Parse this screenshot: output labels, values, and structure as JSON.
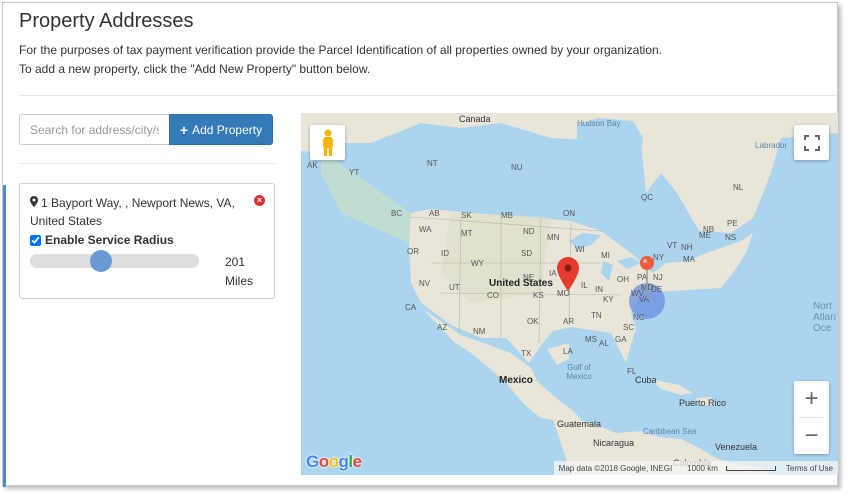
{
  "header": {
    "title": "Property Addresses",
    "description_line1": "For the purposes of tax payment verification provide the Parcel Identification of all properties owned by your organization.",
    "description_line2": "To add a new property, click the \"Add New Property\" button below."
  },
  "search": {
    "placeholder": "Search for address/city/state",
    "value": ""
  },
  "add_button": {
    "label": "Add Property",
    "icon": "plus-icon"
  },
  "properties": [
    {
      "address": "1 Bayport Way, , Newport News, VA, United States",
      "enable_service_radius_label": "Enable Service Radius",
      "enable_service_radius_checked": true,
      "radius_value": "201",
      "radius_unit": "Miles",
      "radius_fraction": 0.41
    }
  ],
  "map": {
    "labels": {
      "canada": "Canada",
      "hudson_bay": "Hudson Bay",
      "labrador": "Labrador",
      "united_states": "United States",
      "mexico": "Mexico",
      "gulf": "Gulf of Mexico",
      "north_atlantic": "Nort Atlan Oce",
      "cuba": "Cuba",
      "puerto_rico": "Puerto Rico",
      "guatemala": "Guatemala",
      "nicaragua": "Nicaragua",
      "caribbean": "Caribbean Sea",
      "venezuela": "Venezuela",
      "colombia": "Colombia"
    },
    "state_labels": [
      "AK",
      "YT",
      "NT",
      "NU",
      "BC",
      "AB",
      "SK",
      "MB",
      "ON",
      "QC",
      "NL",
      "WA",
      "MT",
      "ND",
      "MN",
      "OR",
      "ID",
      "SD",
      "WI",
      "NY",
      "ME",
      "WY",
      "NE",
      "IA",
      "MI",
      "PA",
      "NV",
      "UT",
      "CO",
      "KS",
      "MO",
      "IL",
      "IN",
      "OH",
      "WV",
      "VA",
      "CA",
      "AZ",
      "NM",
      "OK",
      "AR",
      "TN",
      "KY",
      "NC",
      "SC",
      "TX",
      "LA",
      "MS",
      "AL",
      "GA",
      "FL",
      "NH",
      "VT",
      "MA",
      "NB",
      "PE",
      "NS",
      "MD",
      "DE",
      "NJ"
    ],
    "attribution": "Map data ©2018 Google, INEGI",
    "scale": "1000 km",
    "terms": "Terms of Use",
    "logo": "Google",
    "zoom_in": "+",
    "zoom_out": "−"
  },
  "colors": {
    "primary": "#337ab7",
    "remove": "#d9302f",
    "radius_circle": "#6a8fe0",
    "marker": "#e53b30",
    "water": "#abd4ee",
    "land": "#e9e5d8"
  }
}
